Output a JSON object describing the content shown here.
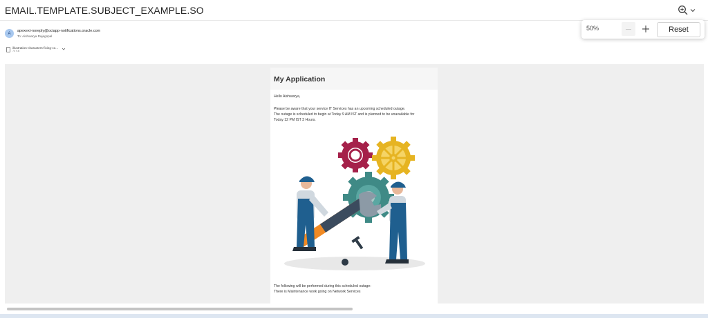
{
  "header": {
    "subject": "EMAIL.TEMPLATE.SUBJECT_EXAMPLE.SO",
    "zoom_icon": "zoom-in-icon"
  },
  "sender": {
    "avatar_initial": "A",
    "from": "apexext-noreply@ociapp-notifications.oracle.com",
    "to": "To: Aishwarya Rajagopal"
  },
  "attachment": {
    "name": "illustration-characters-fixing-co...",
    "size": "75 KB",
    "icon": "file-icon"
  },
  "zoom_popup": {
    "level": "50%",
    "reset_label": "Reset",
    "zoom_percent": 50
  },
  "email": {
    "app_title": "My Application",
    "greeting": "Hello Aishwarya,",
    "line1": "Please be aware that your service IT Services has an upcoming scheduled outage.",
    "line2": "The outage is scheduled to begin at Today 9 AM IST and is planned to be unavailable for",
    "line3": "Today 12 PM IST 3 Hours.",
    "line4": "The following will be performed during this scheduled outage:",
    "line5": "There is Maintenance work going on Network Services"
  },
  "colors": {
    "gear_red": "#a5214a",
    "gear_yellow": "#e6b422",
    "gear_teal": "#3f8a86",
    "wrench_orange": "#f08a24",
    "worker_blue": "#1f5f8f",
    "background_gray": "#efefef"
  }
}
